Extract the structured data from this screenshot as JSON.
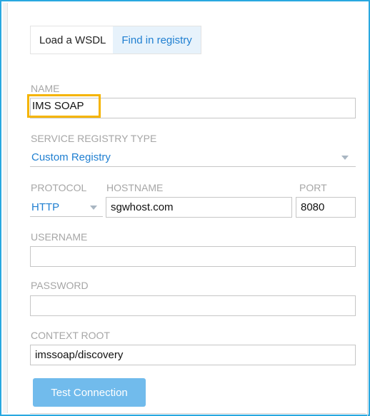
{
  "tabs": [
    {
      "label": "Load a WSDL",
      "active": false
    },
    {
      "label": "Find in registry",
      "active": true
    }
  ],
  "form": {
    "name": {
      "label": "NAME",
      "value": "IMS SOAP"
    },
    "service_registry_type": {
      "label": "SERVICE REGISTRY TYPE",
      "value": "Custom Registry"
    },
    "protocol": {
      "label": "PROTOCOL",
      "value": "HTTP"
    },
    "hostname": {
      "label": "HOSTNAME",
      "value": "sgwhost.com"
    },
    "port": {
      "label": "PORT",
      "value": "8080"
    },
    "username": {
      "label": "USERNAME",
      "value": ""
    },
    "password": {
      "label": "PASSWORD",
      "value": ""
    },
    "context_root": {
      "label": "CONTEXT ROOT",
      "value": "imssoap/discovery"
    }
  },
  "actions": {
    "test_connection": "Test Connection"
  },
  "colors": {
    "accent": "#1f7fd1",
    "highlight": "#f5b400",
    "frame": "#29a8e0",
    "button": "#71bbec"
  },
  "icons": {
    "dropdown": "chevron-down-icon"
  }
}
